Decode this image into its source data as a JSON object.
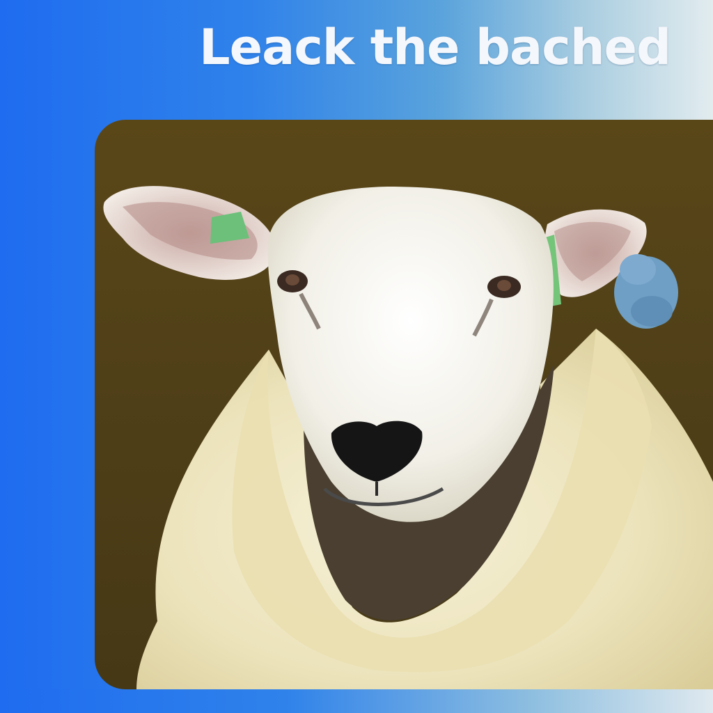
{
  "header": {
    "headline": "Leack the bached"
  },
  "photo": {
    "subject_icon": "sheep-illustration",
    "colors": {
      "background": "#4f3f18",
      "face": "#f4f2ea",
      "fleece": "#eee6c2",
      "ear_tag": "#6cc07a",
      "blue_tuft": "#6f9fc4"
    }
  },
  "theme": {
    "gradient_start": "#1f6cf0",
    "gradient_end": "#e2ecef"
  }
}
